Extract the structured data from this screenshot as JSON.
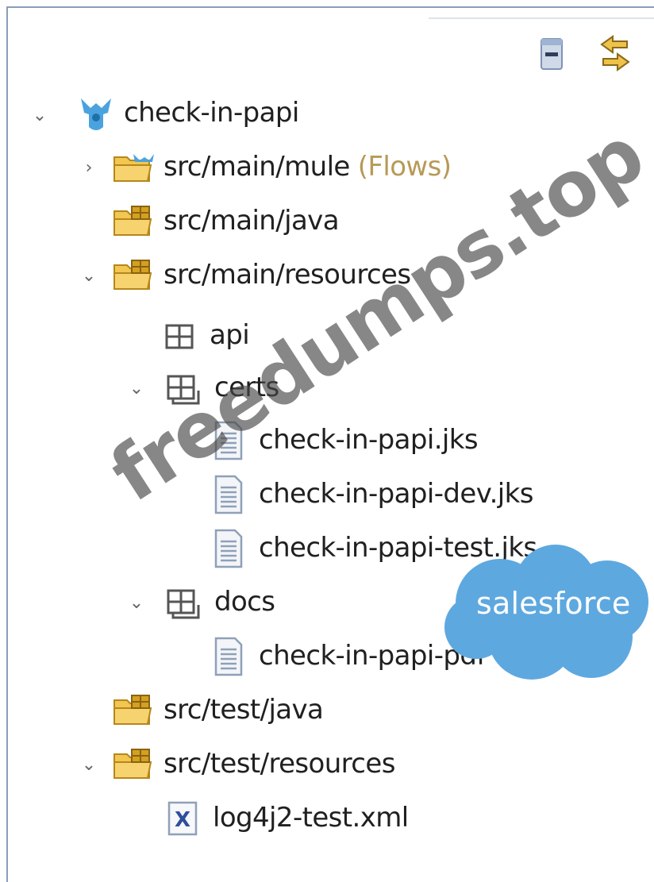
{
  "toolbar": {
    "collapse_all_icon": "collapse-all-icon",
    "link_with_editor_icon": "link-with-editor-icon"
  },
  "tree": {
    "project": {
      "label": "check-in-papi",
      "icon": "mule-project-icon"
    },
    "nodes": [
      {
        "label": "src/main/mule",
        "decoration": "(Flows)",
        "icon": "folder-icon"
      },
      {
        "label": "src/main/java",
        "icon": "source-folder-icon"
      },
      {
        "label": "src/main/resources",
        "icon": "source-folder-icon"
      },
      {
        "label": "api",
        "icon": "package-icon"
      },
      {
        "label": "certs",
        "icon": "package-icon"
      },
      {
        "label": "check-in-papi.jks",
        "icon": "file-icon"
      },
      {
        "label": "check-in-papi-dev.jks",
        "icon": "file-icon"
      },
      {
        "label": "check-in-papi-test.jks",
        "icon": "file-icon"
      },
      {
        "label": "docs",
        "icon": "package-icon"
      },
      {
        "label": "check-in-papi-pdf",
        "icon": "file-icon"
      },
      {
        "label": "src/test/java",
        "icon": "source-folder-icon"
      },
      {
        "label": "src/test/resources",
        "icon": "source-folder-icon"
      },
      {
        "label": "log4j2-test.xml",
        "icon": "xml-file-icon"
      }
    ]
  },
  "overlays": {
    "watermark": "freedumps.top",
    "salesforce_logo": "salesforce"
  },
  "colors": {
    "frame": "#8a9db8",
    "folder": "#e7b53b",
    "salesforce_blue": "#5ea8e0"
  }
}
